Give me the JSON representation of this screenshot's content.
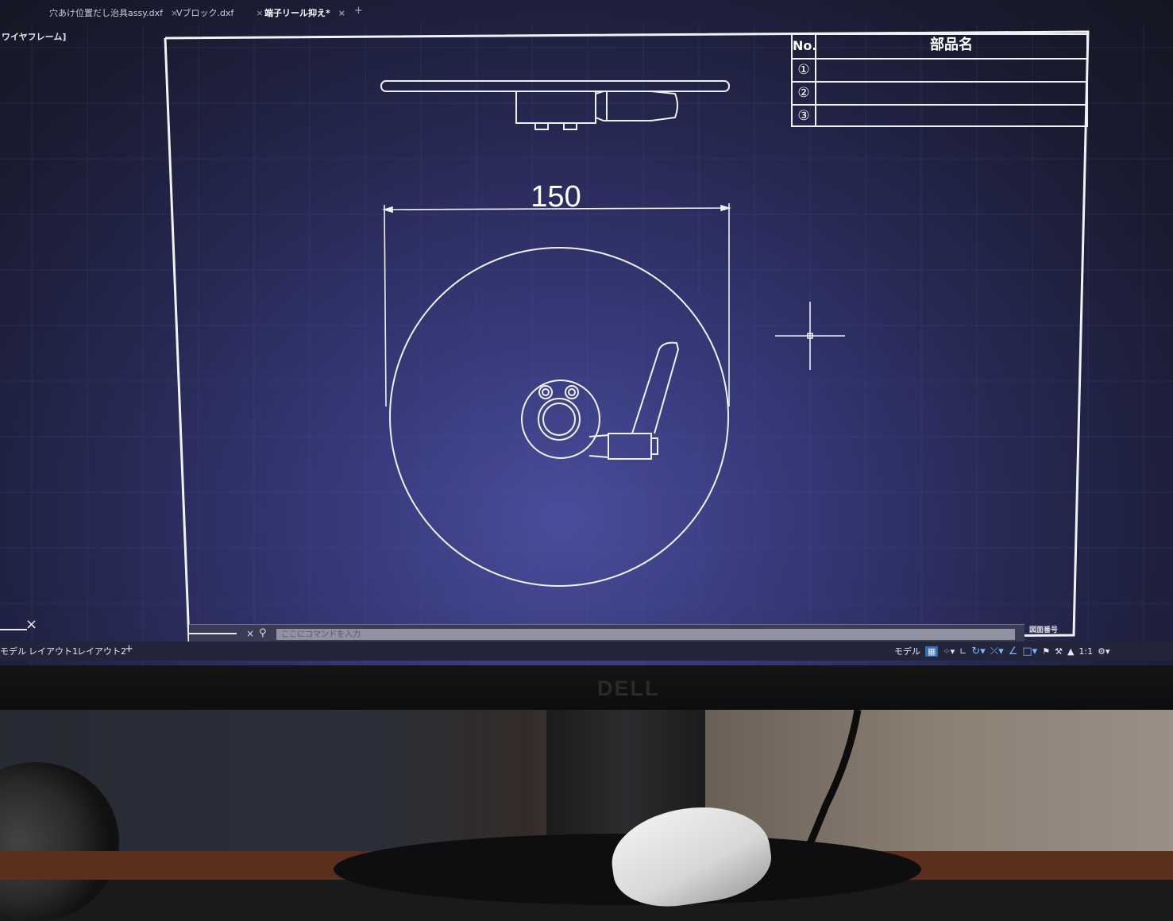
{
  "file_tabs": [
    {
      "label": "穴あけ位置だし治具assy.dxf",
      "close": "×"
    },
    {
      "label": "Vブロック.dxf",
      "close": "×"
    },
    {
      "label": "端子リール抑え*",
      "close": "×"
    }
  ],
  "new_tab_symbol": "+",
  "viewport_label": "ワイヤフレーム]",
  "parts_table": {
    "header_no": "No.",
    "header_name": "部品名",
    "rows": [
      {
        "no": "①",
        "name": ""
      },
      {
        "no": "②",
        "name": ""
      },
      {
        "no": "③",
        "name": ""
      }
    ]
  },
  "drawing": {
    "dimension_text": "150"
  },
  "command_line": {
    "placeholder": "ここにコマンドを入力",
    "close_symbol": "×"
  },
  "drawing_number_label": "図面番号",
  "left_panel_close": "×",
  "layout_tabs": [
    {
      "label": "モデル"
    },
    {
      "label": "レイアウト1"
    },
    {
      "label": "レイアウト2"
    }
  ],
  "layout_add": "+",
  "status_bar": {
    "model_label": "モデル",
    "scale_label": "1:1"
  },
  "monitor_brand": "DELL",
  "colors": {
    "background_center": "#4a4d9c",
    "line": "#f0f0f4",
    "accent_blue": "#2f6fb5"
  }
}
